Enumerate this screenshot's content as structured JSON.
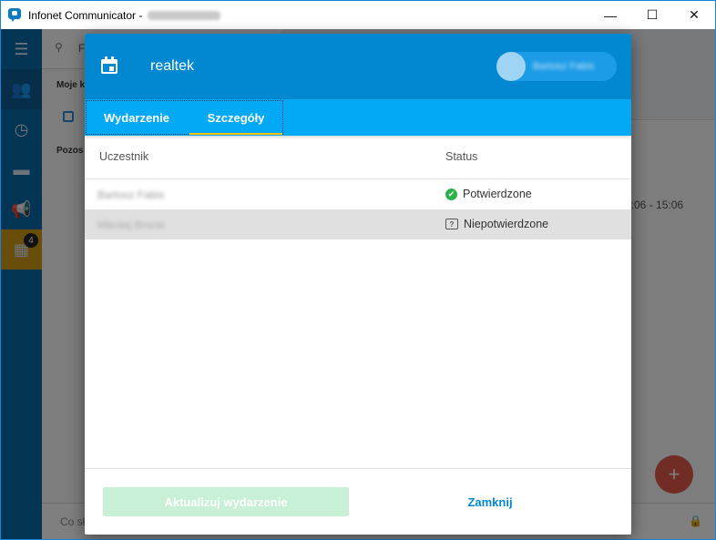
{
  "window": {
    "title": "Infonet Communicator - ",
    "user_blurred": "Mikołaj Brocki",
    "controls": {
      "minimize": "—",
      "maximize": "☐",
      "close": "✕"
    }
  },
  "background": {
    "search_letter": "F",
    "section_1": "Moje k",
    "section_2": "Pozos",
    "time_range": "4:06 - 15:06",
    "compose_placeholder": "Co sł",
    "calendar_badge": "4",
    "fab_label": "+"
  },
  "dialog": {
    "title": "realtek",
    "author_blurred": "Bartosz Fabis",
    "tabs": [
      {
        "label": "Wydarzenie"
      },
      {
        "label": "Szczegóły"
      }
    ],
    "table": {
      "headers": {
        "participant": "Uczestnik",
        "status": "Status"
      },
      "rows": [
        {
          "name": "Bartosz Fabis",
          "status": "Potwierdzone",
          "status_icon": "check-circle-icon"
        },
        {
          "name": "Mikołaj Brocki",
          "status": "Niepotwierdzone",
          "status_icon": "question-bubble-icon"
        }
      ]
    },
    "footer": {
      "update_label": "Aktualizuj wydarzenie",
      "close_label": "Zamknij"
    }
  },
  "colors": {
    "header": "#0288d1",
    "tabs": "#03a9f4",
    "tab_indicator": "#ffc107",
    "confirmed": "#2bb34a",
    "sidebar": "#0a6ba8"
  }
}
